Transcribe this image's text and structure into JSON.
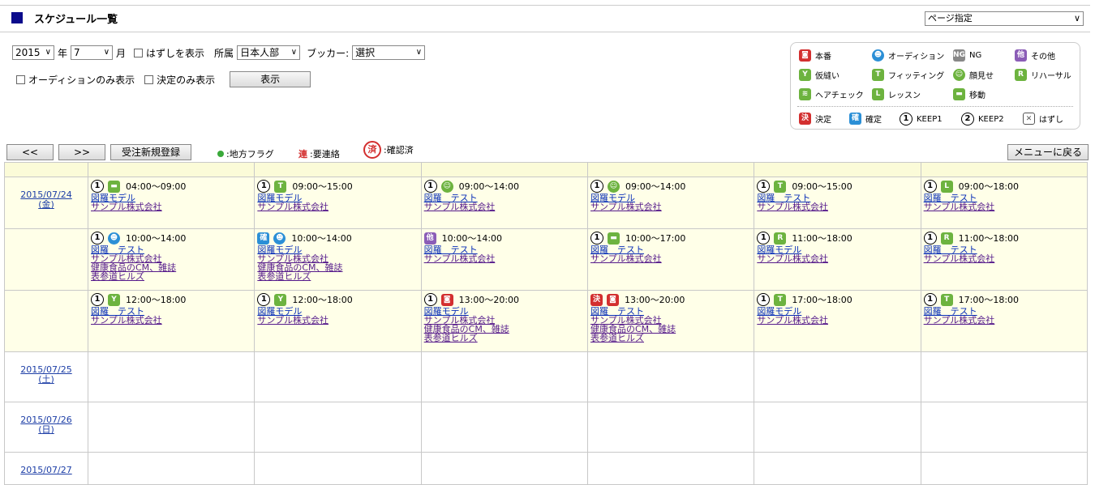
{
  "header": {
    "title": "スケジュール一覧",
    "page_select": "ページ指定"
  },
  "filters": {
    "year": "2015",
    "year_suffix": "年",
    "month": "7",
    "month_suffix": "月",
    "show_removed": "はずしを表示",
    "dept_label": "所属",
    "dept": "日本人部",
    "booker_label": "ブッカー:",
    "booker": "選択",
    "audition_only": "オーディションのみ表示",
    "decided_only": "決定のみ表示",
    "display_button": "表示"
  },
  "legend": {
    "honban": "本番",
    "audition": "オーディション",
    "ng": "NG",
    "ng_icon": "NG",
    "other": "その他",
    "other_icon": "他",
    "kari": "仮縫い",
    "fitting": "フィッティング",
    "kaomise": "顔見せ",
    "rehearsal": "リハーサル",
    "rehearsal_icon": "R",
    "hair": "ヘアチェック",
    "lesson": "レッスン",
    "lesson_icon": "L",
    "move": "移動",
    "decided": "決定",
    "decided_icon": "決",
    "confirmed": "確定",
    "confirmed_icon": "確",
    "keep1": "KEEP1",
    "keep1_icon": "1",
    "keep2": "KEEP2",
    "keep2_icon": "2",
    "removed": "はずし"
  },
  "nav": {
    "prev": "<<",
    "next": ">>",
    "new_order": "受注新規登録",
    "local_flag": ":地方フラグ",
    "contact_mark": "連",
    "contact": ":要連絡",
    "checked_mark": "済",
    "checked": ":確認済",
    "back": "メニューに戻る"
  },
  "days": [
    {
      "date": "2015/07/24",
      "dow": "(金)",
      "rows": [
        [
          {
            "badge": "1",
            "icon": "car-icon",
            "time": "04:00～09:00",
            "l1": "図羅モデル",
            "l2": "サンプル株式会社"
          },
          {
            "badge": "1",
            "icon": "shirt-icon",
            "time": "09:00～15:00",
            "l1": "図羅モデル",
            "l2": "サンプル株式会社"
          },
          {
            "badge": "1",
            "icon": "smile-icon",
            "time": "09:00～14:00",
            "l1": "図羅　テスト",
            "l2": "サンプル株式会社"
          },
          {
            "badge": "1",
            "icon": "smile-icon",
            "time": "09:00～14:00",
            "l1": "図羅モデル",
            "l2": "サンプル株式会社"
          },
          {
            "badge": "1",
            "icon": "shirt-icon",
            "time": "09:00～15:00",
            "l1": "図羅　テスト",
            "l2": "サンプル株式会社"
          },
          {
            "badge": "1",
            "icon": "lesson-icon",
            "time": "09:00～18:00",
            "l1": "図羅　テスト",
            "l2": "サンプル株式会社"
          }
        ],
        [
          {
            "badge": "1",
            "icon": "people-icon",
            "time": "10:00～14:00",
            "l1": "図羅　テスト",
            "l2": "サンプル株式会社",
            "l3": "健康食品のCM、雑誌",
            "l4": "表参道ヒルズ"
          },
          {
            "badge": "確",
            "icon": "people-icon",
            "time": "10:00～14:00",
            "l1": "図羅モデル",
            "l2": "サンプル株式会社",
            "l3": "健康食品のCM、雑誌",
            "l4": "表参道ヒルズ"
          },
          {
            "badge": "他",
            "icon": "",
            "time": "10:00～14:00",
            "l1": "図羅　テスト",
            "l2": "サンプル株式会社"
          },
          {
            "badge": "1",
            "icon": "car-icon",
            "time": "10:00～17:00",
            "l1": "図羅　テスト",
            "l2": "サンプル株式会社"
          },
          {
            "badge": "1",
            "icon": "rehearsal-icon",
            "time": "11:00～18:00",
            "l1": "図羅モデル",
            "l2": "サンプル株式会社"
          },
          {
            "badge": "1",
            "icon": "rehearsal-icon",
            "time": "11:00～18:00",
            "l1": "図羅　テスト",
            "l2": "サンプル株式会社"
          }
        ],
        [
          {
            "badge": "1",
            "icon": "fitting-icon",
            "time": "12:00～18:00",
            "l1": "図羅　テスト",
            "l2": "サンプル株式会社"
          },
          {
            "badge": "1",
            "icon": "fitting-icon",
            "time": "12:00～18:00",
            "l1": "図羅モデル",
            "l2": "サンプル株式会社"
          },
          {
            "badge": "1",
            "icon": "camera-icon",
            "time": "13:00～20:00",
            "l1": "図羅モデル",
            "l2": "サンプル株式会社",
            "l3": "健康食品のCM、雑誌",
            "l4": "表参道ヒルズ"
          },
          {
            "badge": "決",
            "icon": "camera-icon",
            "time": "13:00～20:00",
            "l1": "図羅　テスト",
            "l2": "サンプル株式会社",
            "l3": "健康食品のCM、雑誌",
            "l4": "表参道ヒルズ"
          },
          {
            "badge": "1",
            "icon": "shirt-icon",
            "time": "17:00～18:00",
            "l1": "図羅モデル",
            "l2": "サンプル株式会社"
          },
          {
            "badge": "1",
            "icon": "shirt-icon",
            "time": "17:00～18:00",
            "l1": "図羅　テスト",
            "l2": "サンプル株式会社"
          }
        ]
      ]
    },
    {
      "date": "2015/07/25",
      "dow": "(土)",
      "rows": []
    },
    {
      "date": "2015/07/26",
      "dow": "(日)",
      "rows": []
    },
    {
      "date": "2015/07/27",
      "dow": "",
      "rows": []
    }
  ],
  "colors": {
    "honban": "#d32f2f",
    "green": "#6db33f",
    "blue": "#2b8fd6",
    "purple": "#8b5db7",
    "gray": "#888888",
    "yellow_row": "#ffffe8"
  }
}
